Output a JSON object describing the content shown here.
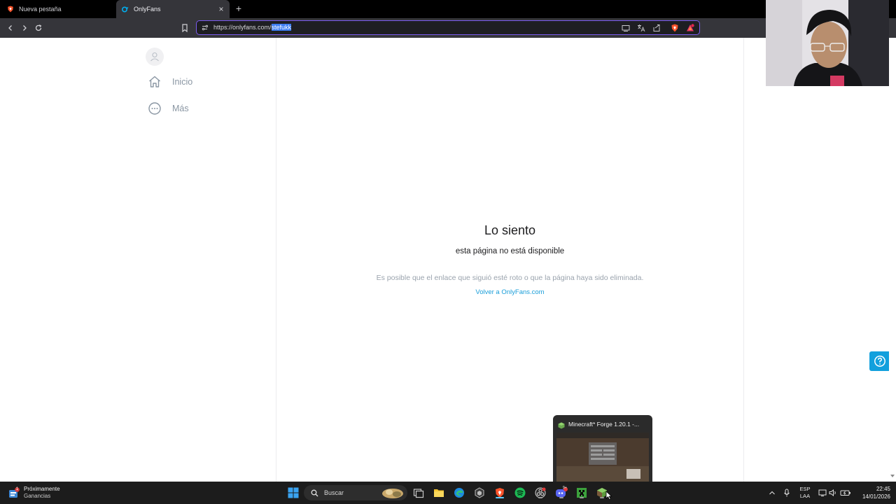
{
  "browser": {
    "tabs": [
      {
        "title": "Nueva pestaña",
        "active": false
      },
      {
        "title": "OnlyFans",
        "active": true
      }
    ],
    "url": {
      "prefix": "https://onlyfans.com/",
      "selected": "stefukk"
    }
  },
  "sidebar": {
    "items": [
      {
        "label": "Inicio",
        "icon": "home-icon"
      },
      {
        "label": "Más",
        "icon": "more-icon"
      }
    ]
  },
  "error": {
    "title": "Lo siento",
    "subtitle": "esta página no está disponible",
    "description": "Es posible que el enlace que siguió esté roto o que la página haya sido eliminada.",
    "link": "Volver a OnlyFans.com"
  },
  "thumbnail": {
    "title": "Minecraft* Forge 1.20.1 -..."
  },
  "taskbar": {
    "weather": {
      "line1": "Próximamente",
      "line2": "Ganancias",
      "badge": "1"
    },
    "search_label": "Buscar",
    "language": {
      "line1": "ESP",
      "line2": "LAA"
    },
    "clock": {
      "time": "22:45",
      "date": "14/01/2026"
    },
    "discord_badge": "9+"
  },
  "colors": {
    "accent_link": "#1a9ed9",
    "urlbar_border": "#7c5cf0",
    "help_button": "#12a0dd"
  }
}
